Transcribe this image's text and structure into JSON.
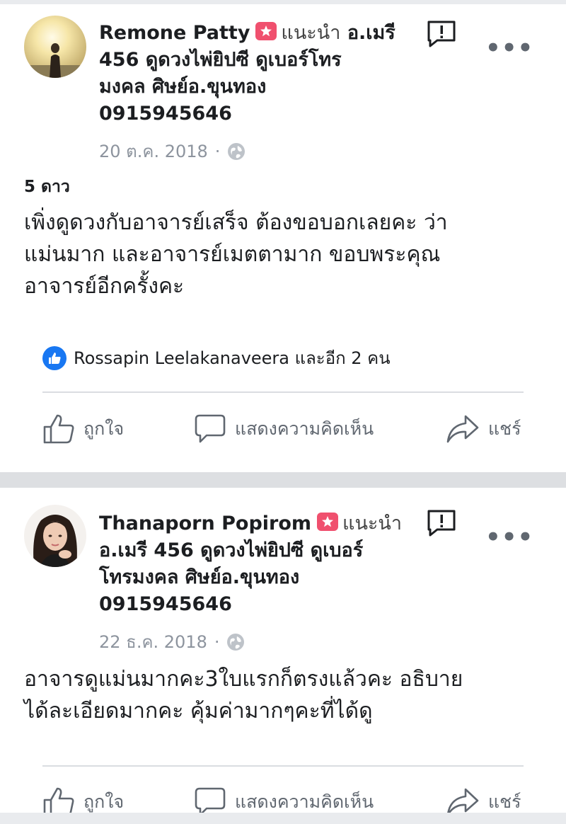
{
  "posts": [
    {
      "author": "Remone Patty",
      "recommend_label": "แนะนำ",
      "page_name": "อ.เมรี 456 ดูดวงไพ่ยิปซี ดูเบอร์โทรมงคล ศิษย์อ.ขุนทอง 0915945646",
      "header_lines": [
        "Remone Patty",
        "แนะนำ",
        "อ.เมรี",
        "456 ดูดวงไพ่ยิปซี ดูเบอร์โทร",
        "มงคล ศิษย์อ.ขุนทอง",
        "0915945646"
      ],
      "date": "20 ต.ค. 2018",
      "separator": "·",
      "rating": "5 ดาว",
      "body_lines": [
        "เพิ่งดูดวงกับอาจารย์เสร็จ ต้องขอบอกเลยคะ ว่า",
        "แม่นมาก และอาจารย์เมตตามาก ขอบพระคุณ",
        "อาจารย์อีกครั้งคะ"
      ],
      "reactions": "Rossapin Leelakanaveera และอีก 2 คน"
    },
    {
      "author": "Thanaporn Popirom",
      "recommend_label": "แนะนำ",
      "header_lines": [
        "Thanaporn Popirom",
        "แนะนำ",
        "อ.เมรี 456 ดูดวงไพ่ยิปซี ดูเบอร์",
        "โทรมงคล ศิษย์อ.ขุนทอง",
        "0915945646"
      ],
      "date": "22 ธ.ค. 2018",
      "separator": "·",
      "body_lines": [
        "อาจารดูแม่นมากคะ3ใบแรกก็ตรงแล้วคะ อธิบาย",
        "ได้ละเอียดมากคะ คุ้มค่ามากๆคะที่ได้ดู"
      ]
    }
  ],
  "actions": {
    "like": "ถูกใจ",
    "comment": "แสดงความคิดเห็น",
    "share": "แชร์"
  },
  "icons": [
    "report-icon",
    "more-icon",
    "globe-icon",
    "like-icon",
    "comment-icon",
    "share-icon",
    "recommend-badge-icon"
  ],
  "colors": {
    "accent_blue": "#1877f2",
    "recommend_badge": "#f0506e",
    "muted_text": "#8d949e",
    "action_text": "#606770",
    "separator_band": "#dddfe2"
  }
}
